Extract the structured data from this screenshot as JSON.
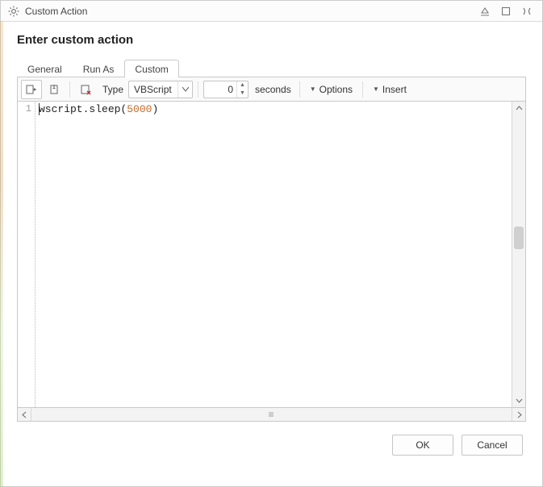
{
  "window": {
    "title": "Custom Action"
  },
  "heading": "Enter custom action",
  "tabs": {
    "general": "General",
    "runas": "Run As",
    "custom": "Custom",
    "active": "custom"
  },
  "toolbar": {
    "type_label": "Type",
    "type_value": "VBScript",
    "delay_value": "0",
    "seconds_label": "seconds",
    "options_label": "Options",
    "insert_label": "Insert"
  },
  "editor": {
    "line_number": "1",
    "code_prefix": "wscript.sleep(",
    "code_number": "5000",
    "code_suffix": ")"
  },
  "buttons": {
    "ok": "OK",
    "cancel": "Cancel"
  }
}
